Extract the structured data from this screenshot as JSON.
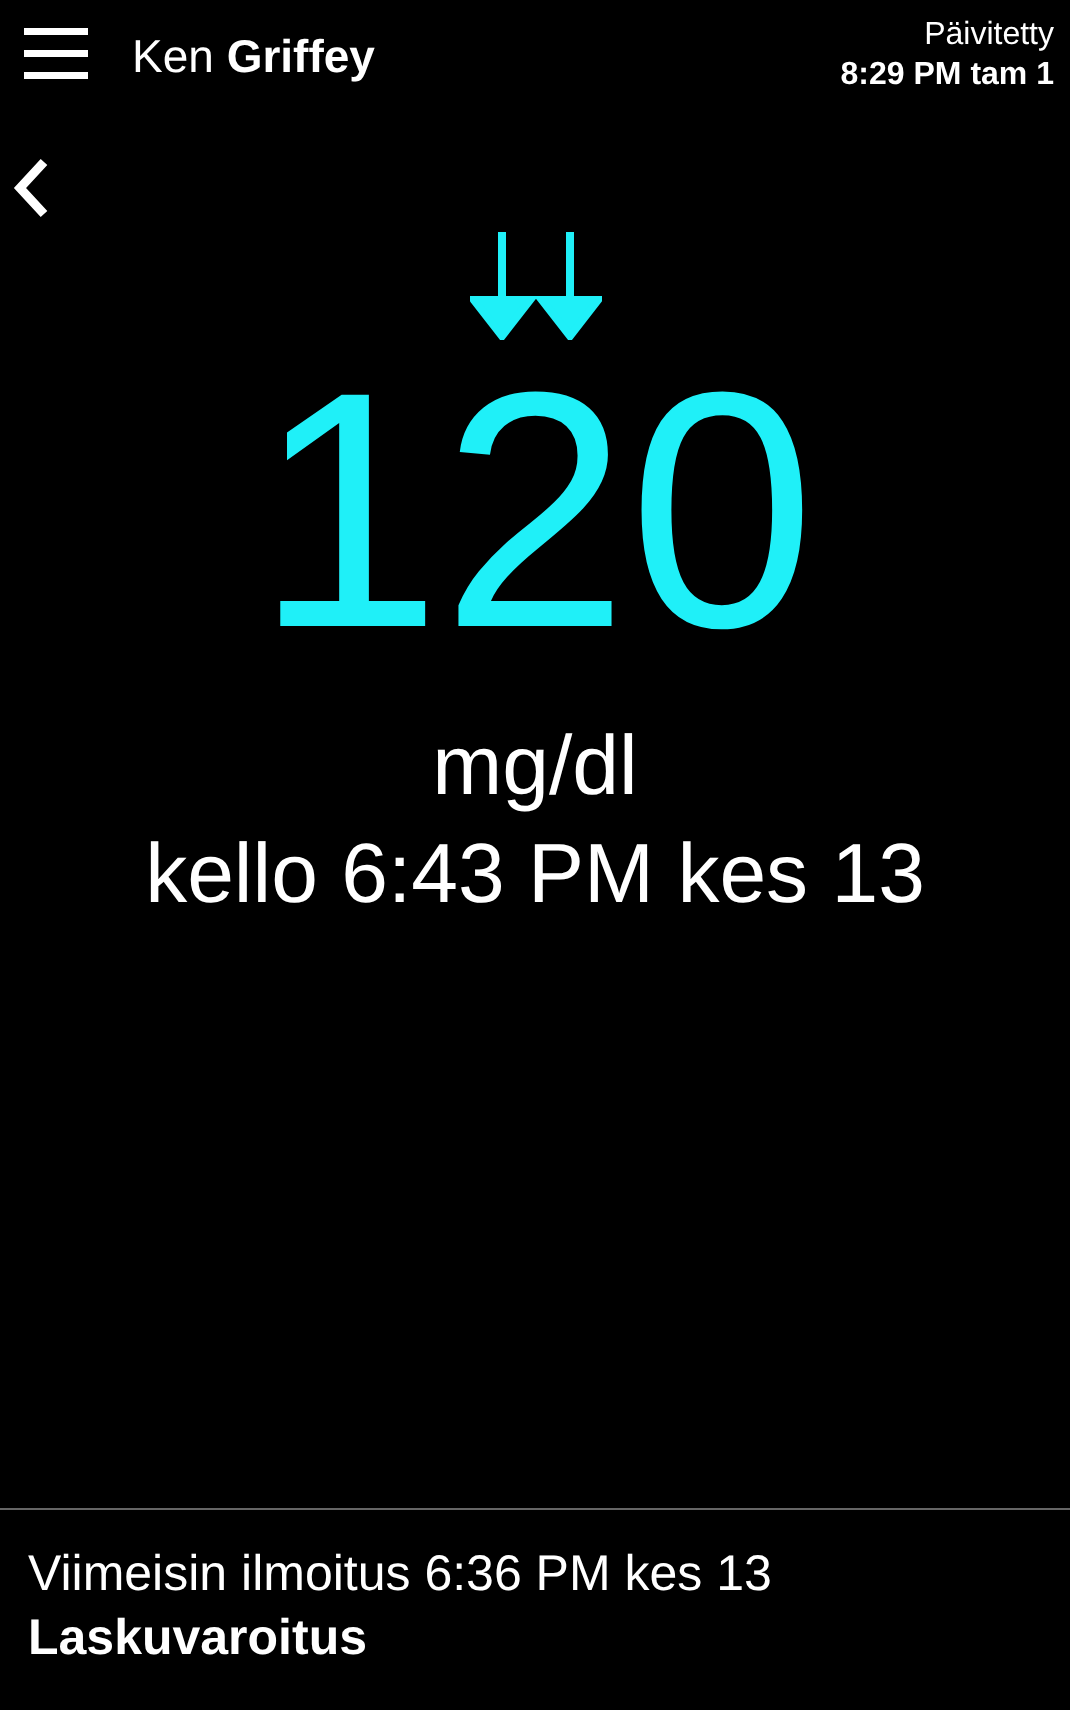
{
  "header": {
    "user_name": "Ken **Griffey**",
    "updated_label": "Päivitetty",
    "updated_time": "8:29 PM tam 1"
  },
  "reading": {
    "value": "120",
    "unit": "mg/dl",
    "time": "kello 6:43 PM kes 13"
  },
  "footer": {
    "last_alert": "Viimeisin ilmoitus 6:36 PM kes 13",
    "alert_type": "Laskuvaroitus"
  }
}
